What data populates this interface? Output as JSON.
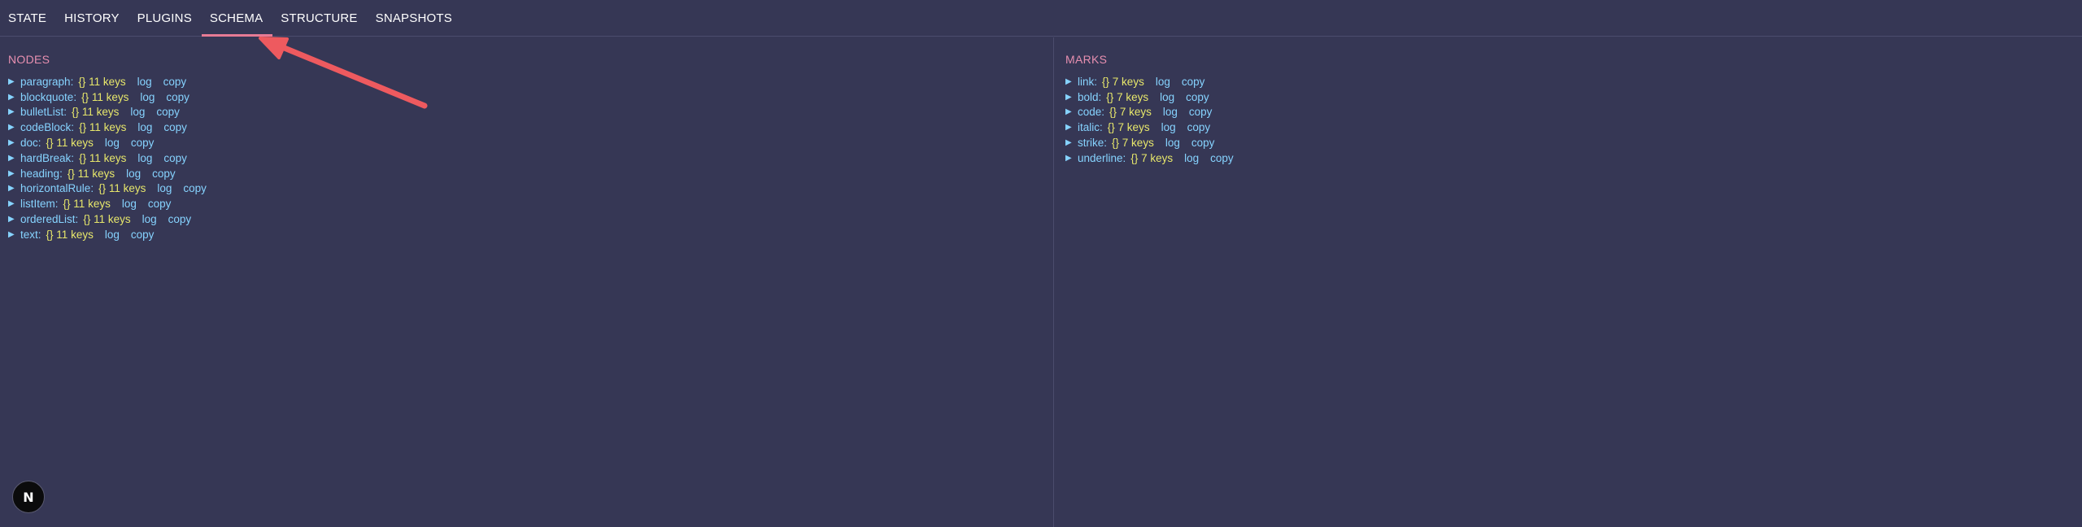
{
  "tabs": [
    {
      "label": "STATE"
    },
    {
      "label": "HISTORY"
    },
    {
      "label": "PLUGINS"
    },
    {
      "label": "SCHEMA",
      "active": true
    },
    {
      "label": "STRUCTURE"
    },
    {
      "label": "SNAPSHOTS"
    }
  ],
  "nodes": {
    "title": "NODES",
    "items": [
      {
        "key": "paragraph",
        "value": "{} 11 keys"
      },
      {
        "key": "blockquote",
        "value": "{} 11 keys"
      },
      {
        "key": "bulletList",
        "value": "{} 11 keys"
      },
      {
        "key": "codeBlock",
        "value": "{} 11 keys"
      },
      {
        "key": "doc",
        "value": "{} 11 keys"
      },
      {
        "key": "hardBreak",
        "value": "{} 11 keys"
      },
      {
        "key": "heading",
        "value": "{} 11 keys"
      },
      {
        "key": "horizontalRule",
        "value": "{} 11 keys"
      },
      {
        "key": "listItem",
        "value": "{} 11 keys"
      },
      {
        "key": "orderedList",
        "value": "{} 11 keys"
      },
      {
        "key": "text",
        "value": "{} 11 keys"
      }
    ]
  },
  "marks": {
    "title": "MARKS",
    "items": [
      {
        "key": "link",
        "value": "{} 7 keys"
      },
      {
        "key": "bold",
        "value": "{} 7 keys"
      },
      {
        "key": "code",
        "value": "{} 7 keys"
      },
      {
        "key": "italic",
        "value": "{} 7 keys"
      },
      {
        "key": "strike",
        "value": "{} 7 keys"
      },
      {
        "key": "underline",
        "value": "{} 7 keys"
      }
    ]
  },
  "actions": {
    "log": "log",
    "copy": "copy"
  },
  "expand_glyph": "▶",
  "badge": {
    "label": "N"
  },
  "colors": {
    "background": "#363755",
    "active_tab_underline": "#e77b95",
    "section_title": "#e78fb0",
    "key": "#86d3ff",
    "value": "#e7e76b",
    "annotation_arrow": "#ee5a5f"
  }
}
